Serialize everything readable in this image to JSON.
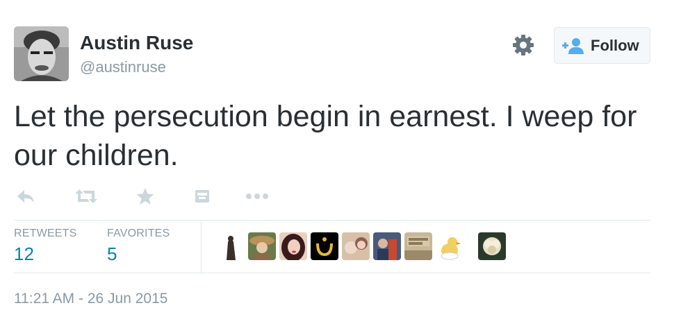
{
  "author": {
    "name": "Austin Ruse",
    "handle": "@austinruse",
    "avatar_icon": "man-portrait-avatar"
  },
  "header": {
    "gear_icon": "gear-icon",
    "follow_label": "Follow",
    "follow_icon": "add-user-icon"
  },
  "tweet": {
    "text": "Let the persecution begin in earnest. I weep for our children."
  },
  "actions": [
    {
      "name": "reply",
      "icon": "reply-icon"
    },
    {
      "name": "retweet",
      "icon": "retweet-icon"
    },
    {
      "name": "favorite",
      "icon": "star-icon"
    },
    {
      "name": "embed",
      "icon": "embed-icon"
    },
    {
      "name": "more",
      "icon": "more-dots-icon"
    }
  ],
  "stats": {
    "retweets_label": "RETWEETS",
    "retweets_value": "12",
    "favorites_label": "FAVORITES",
    "favorites_value": "5"
  },
  "favoriters": [
    {
      "name": "favoriter-1",
      "colors": [
        "#ffffff",
        "#3a3028"
      ]
    },
    {
      "name": "favoriter-2",
      "colors": [
        "#b8925a",
        "#6a7a4a"
      ]
    },
    {
      "name": "favoriter-3",
      "colors": [
        "#e8d0c0",
        "#3a1a1a"
      ]
    },
    {
      "name": "favoriter-4",
      "colors": [
        "#000000",
        "#e8b830"
      ]
    },
    {
      "name": "favoriter-5",
      "colors": [
        "#d8c0a8",
        "#8a6050"
      ]
    },
    {
      "name": "favoriter-6",
      "colors": [
        "#4a5a7a",
        "#c84830"
      ]
    },
    {
      "name": "favoriter-7",
      "colors": [
        "#c8b898",
        "#8a7a5a"
      ]
    },
    {
      "name": "favoriter-8",
      "colors": [
        "#ffffff",
        "#f0d060"
      ]
    },
    {
      "name": "favoriter-9",
      "colors": [
        "#2a3a2a",
        "#e8e0c8"
      ]
    }
  ],
  "timestamp": "11:21 AM - 26 Jun 2015",
  "colors": {
    "link": "#0084b4",
    "muted": "#8899a6",
    "text": "#292f33",
    "border": "#e1e8ed",
    "icon": "#ccd6dd"
  }
}
